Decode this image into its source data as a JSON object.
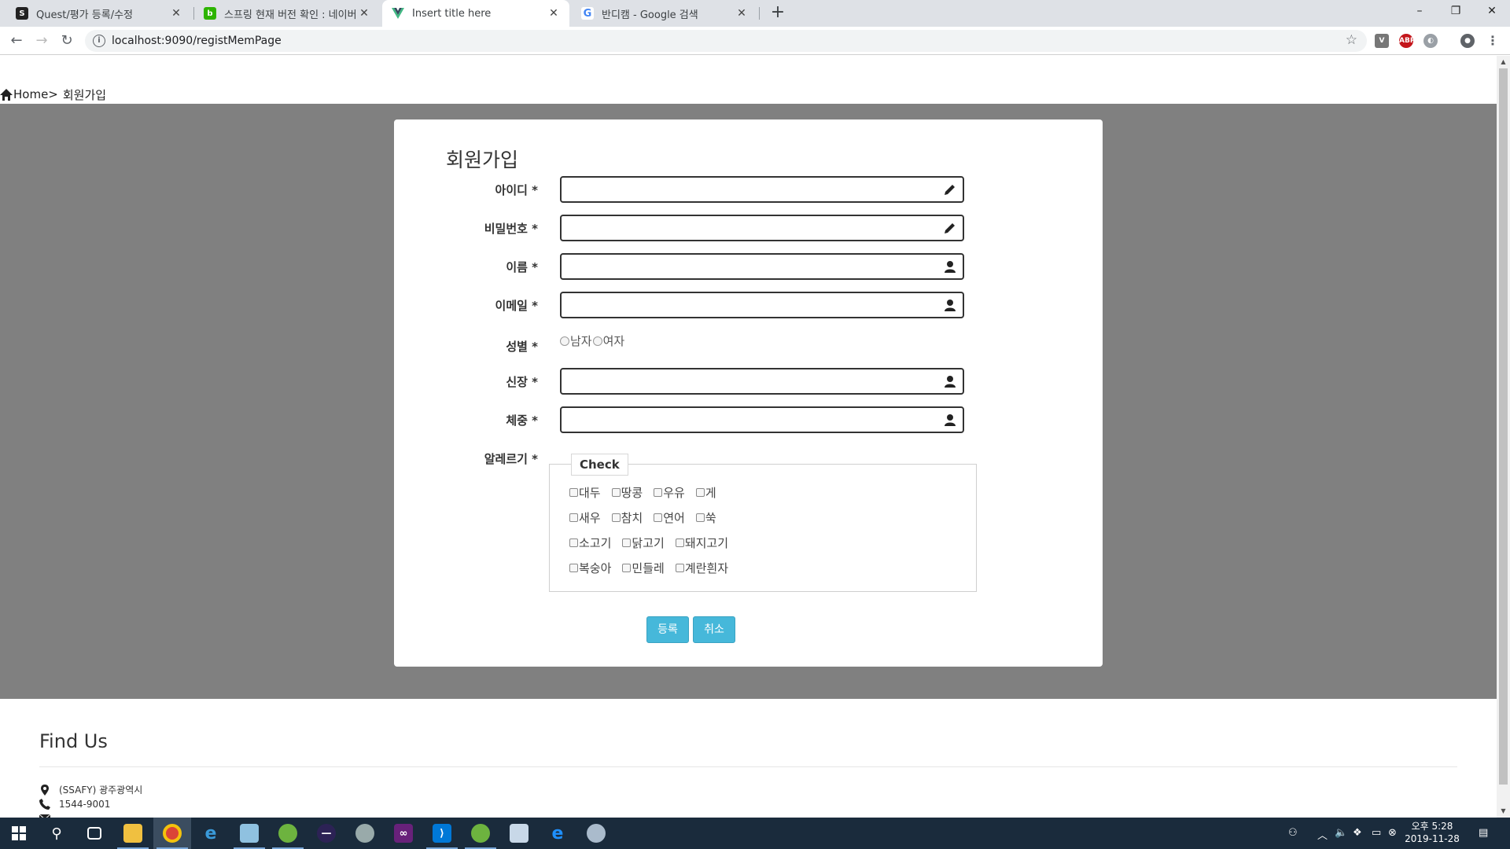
{
  "browser": {
    "tabs": [
      {
        "title": "Quest/평가 등록/수정",
        "icon": "quest-favicon",
        "active": false
      },
      {
        "title": "스프링 현재 버전 확인 : 네이버",
        "icon": "naver-blog-favicon",
        "active": false
      },
      {
        "title": "Insert title here",
        "icon": "vue-favicon",
        "active": true
      },
      {
        "title": "반디캠 - Google 검색",
        "icon": "google-favicon",
        "active": false
      }
    ],
    "new_tab_label": "+",
    "url": "localhost:9090/registMemPage",
    "window_controls": {
      "minimize": "–",
      "restore": "❐",
      "close": "✕"
    }
  },
  "breadcrumb": {
    "home": "Home",
    "separator": ">",
    "current": "회원가입"
  },
  "form": {
    "title": "회원가입",
    "fields": [
      {
        "label": "아이디 *",
        "icon": "pencil-icon",
        "value": ""
      },
      {
        "label": "비밀번호 *",
        "icon": "pencil-icon",
        "value": ""
      },
      {
        "label": "이름 *",
        "icon": "user-icon",
        "value": ""
      },
      {
        "label": "이메일 *",
        "icon": "user-icon",
        "value": ""
      },
      {
        "label": "신장 *",
        "icon": "user-icon",
        "value": ""
      },
      {
        "label": "체중 *",
        "icon": "user-icon",
        "value": ""
      }
    ],
    "gender": {
      "label": "성별 *",
      "options": [
        "남자",
        "여자"
      ]
    },
    "allergy": {
      "label": "알레르기 *",
      "legend": "Check",
      "rows": [
        [
          "대두",
          "땅콩",
          "우유",
          "게"
        ],
        [
          "새우",
          "참치",
          "연어",
          "쑥"
        ],
        [
          "소고기",
          "닭고기",
          "돼지고기"
        ],
        [
          "복숭아",
          "민들레",
          "계란흰자"
        ]
      ]
    },
    "buttons": {
      "submit": "등록",
      "cancel": "취소"
    }
  },
  "footer": {
    "title": "Find Us",
    "address": "(SSAFY) 광주광역시",
    "phone": "1544-9001"
  },
  "taskbar": {
    "time": "오후 5:28",
    "date": "2019-11-28",
    "apps": [
      "windows-start",
      "search",
      "task-view",
      "file-explorer",
      "chrome",
      "internet-explorer",
      "notepad",
      "spring-tool-suite",
      "eclipse",
      "paint-tool",
      "visual-studio",
      "vscode",
      "spring-boot",
      "calculator",
      "edge",
      "paint"
    ]
  },
  "colors": {
    "page_band": "#808080",
    "button": "#46b8da",
    "taskbar": "#1a2b3c",
    "tabbar": "#dee1e6"
  }
}
